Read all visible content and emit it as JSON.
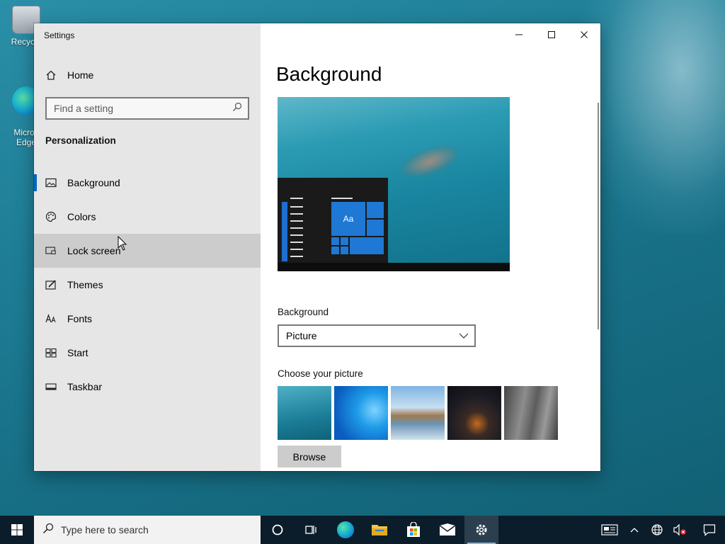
{
  "desktop": {
    "icons": [
      {
        "label": "Recycle"
      },
      {
        "label": "Micros\nEdge"
      }
    ]
  },
  "window": {
    "title": "Settings",
    "controls": {
      "minimize": "—",
      "maximize": "☐",
      "close": "✕"
    }
  },
  "sidebar": {
    "home_label": "Home",
    "search_placeholder": "Find a setting",
    "section_title": "Personalization",
    "items": [
      {
        "label": "Background",
        "icon": "picture-icon",
        "selected": true
      },
      {
        "label": "Colors",
        "icon": "palette-icon"
      },
      {
        "label": "Lock screen",
        "icon": "lock-screen-icon",
        "hovered": true
      },
      {
        "label": "Themes",
        "icon": "brush-icon"
      },
      {
        "label": "Fonts",
        "icon": "font-icon"
      },
      {
        "label": "Start",
        "icon": "start-tiles-icon"
      },
      {
        "label": "Taskbar",
        "icon": "taskbar-icon"
      }
    ]
  },
  "content": {
    "title": "Background",
    "preview_tile_label": "Aa",
    "background_label": "Background",
    "background_value": "Picture",
    "choose_label": "Choose your picture",
    "browse_label": "Browse"
  },
  "taskbar": {
    "search_placeholder": "Type here to search",
    "apps": [
      "cortana-icon",
      "task-view-icon",
      "edge-icon",
      "file-explorer-icon",
      "store-icon",
      "mail-icon",
      "settings-icon"
    ],
    "active_app": "settings-icon"
  },
  "colors": {
    "accent": "#0067c0",
    "tile_blue": "#1e78d4",
    "taskbar_bg": "#0b1d2a"
  }
}
